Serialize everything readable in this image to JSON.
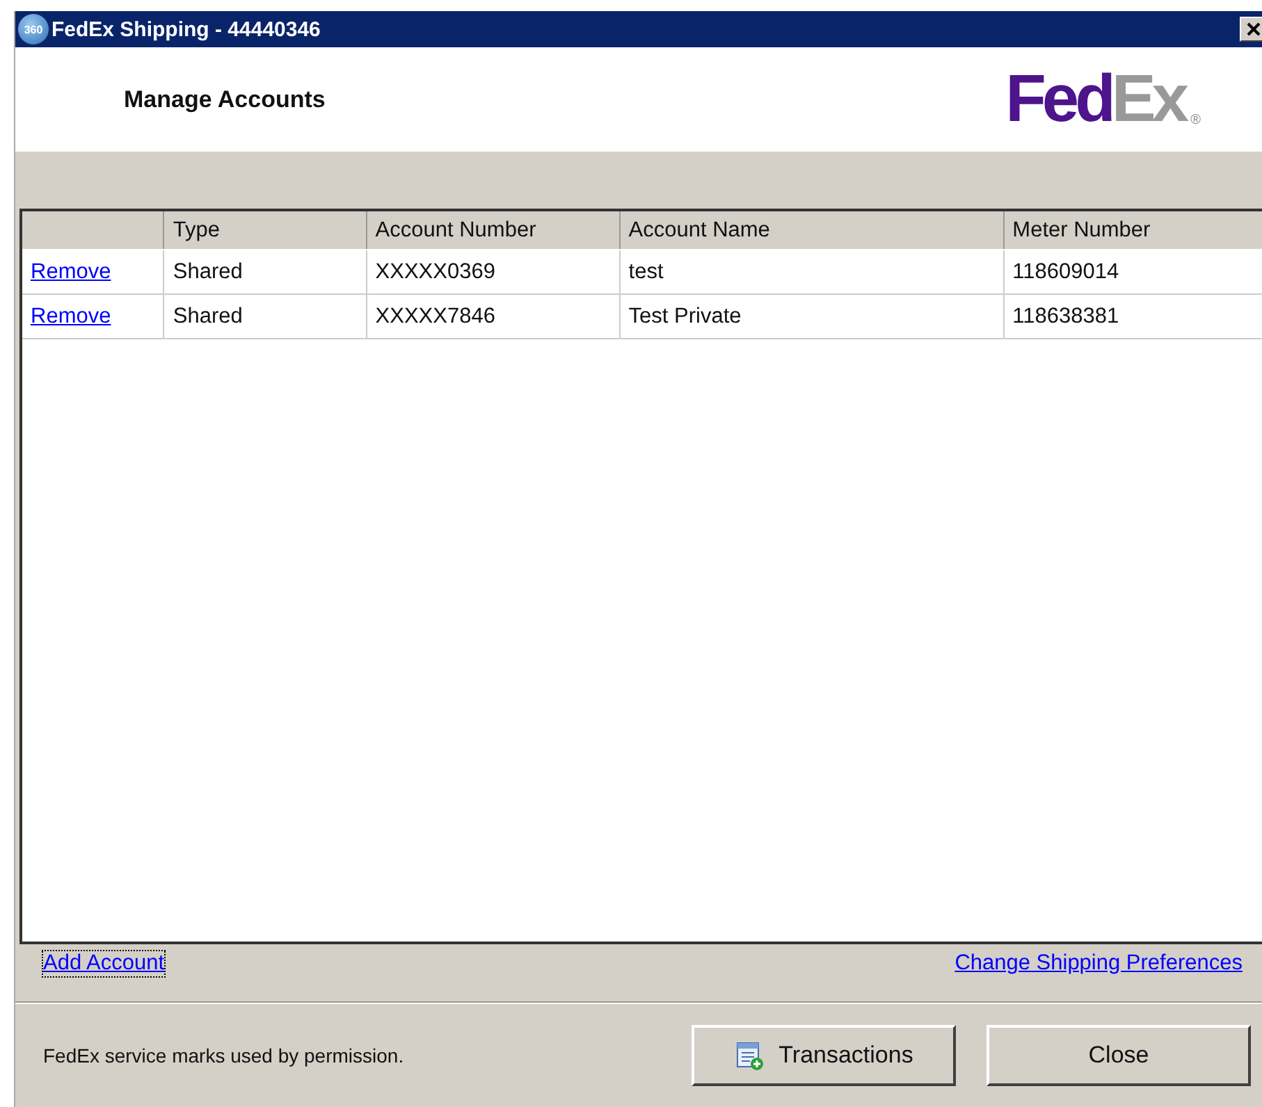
{
  "window": {
    "title": "FedEx Shipping - 44440346",
    "app_icon_text": "360"
  },
  "header": {
    "title": "Manage Accounts",
    "logo": {
      "parts": [
        "Fed",
        "Ex"
      ],
      "mark": "®"
    }
  },
  "table": {
    "columns": [
      "",
      "Type",
      "Account Number",
      "Account Name",
      "Meter Number"
    ],
    "rows": [
      {
        "action": "Remove",
        "type": "Shared",
        "account_number": "XXXXX0369",
        "account_name": "test",
        "meter_number": "118609014"
      },
      {
        "action": "Remove",
        "type": "Shared",
        "account_number": "XXXXX7846",
        "account_name": "Test Private",
        "meter_number": "118638381"
      }
    ]
  },
  "links": [
    {
      "label": "Add Account",
      "focused": true
    },
    {
      "label": "Change Shipping Preferences",
      "focused": false
    }
  ],
  "footer": {
    "note": "FedEx service marks used by permission.",
    "buttons": [
      {
        "label": "Transactions",
        "kind": "icon"
      },
      {
        "label": "Close",
        "kind": "plain"
      }
    ]
  }
}
